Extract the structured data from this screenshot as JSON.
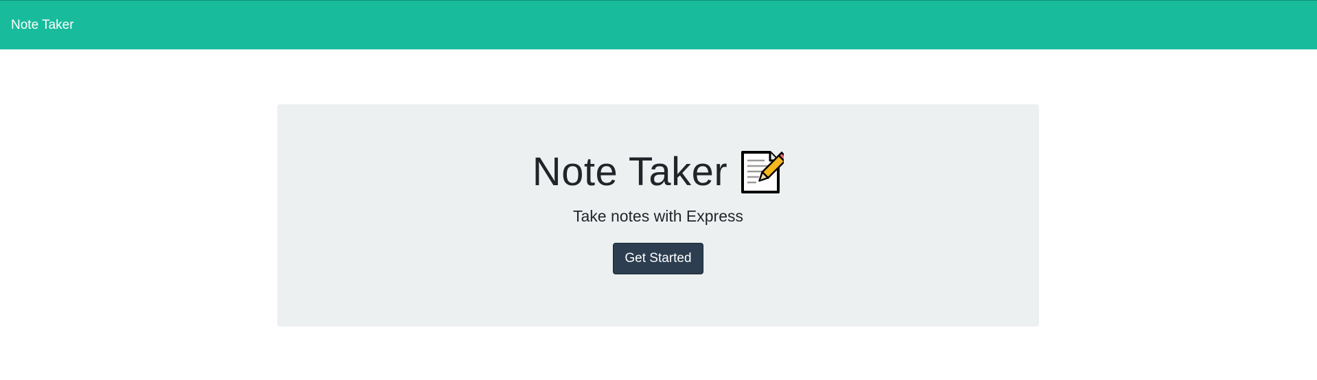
{
  "navbar": {
    "brand": "Note Taker",
    "background_color": "#18bc9c"
  },
  "hero": {
    "title": "Note Taker",
    "icon": "memo-icon",
    "subtitle": "Take notes with Express",
    "button_label": "Get Started",
    "background_color": "#ecf0f1",
    "button_color": "#2c3e50"
  }
}
